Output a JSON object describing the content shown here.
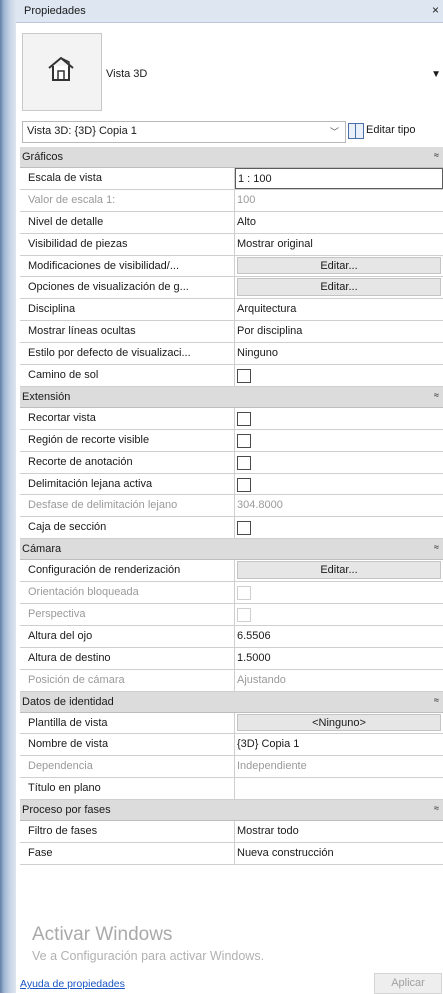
{
  "window": {
    "title": "Propiedades",
    "close": "×"
  },
  "type_selector": {
    "name": "Vista 3D",
    "icon": "house-3d-icon"
  },
  "instance": {
    "selected": "Vista 3D: {3D} Copia 1",
    "edit_type_label": "Editar tipo"
  },
  "sections": [
    {
      "title": "Gráficos",
      "rows": [
        {
          "name": "Escala de vista",
          "kind": "input",
          "value": "1 : 100"
        },
        {
          "name": "Valor de escala    1:",
          "kind": "text",
          "value": "100",
          "disabled": true
        },
        {
          "name": "Nivel de detalle",
          "kind": "text",
          "value": "Alto"
        },
        {
          "name": "Visibilidad de piezas",
          "kind": "text",
          "value": "Mostrar original"
        },
        {
          "name": "Modificaciones de visibilidad/...",
          "kind": "button",
          "value": "Editar..."
        },
        {
          "name": "Opciones de visualización de g...",
          "kind": "button",
          "value": "Editar..."
        },
        {
          "name": "Disciplina",
          "kind": "text",
          "value": "Arquitectura"
        },
        {
          "name": "Mostrar líneas ocultas",
          "kind": "text",
          "value": "Por disciplina"
        },
        {
          "name": "Estilo por defecto de visualizaci...",
          "kind": "text",
          "value": "Ninguno"
        },
        {
          "name": "Camino de sol",
          "kind": "check",
          "checked": false
        }
      ]
    },
    {
      "title": "Extensión",
      "rows": [
        {
          "name": "Recortar vista",
          "kind": "check",
          "checked": false
        },
        {
          "name": "Región de recorte visible",
          "kind": "check",
          "checked": false
        },
        {
          "name": "Recorte de anotación",
          "kind": "check",
          "checked": false
        },
        {
          "name": "Delimitación lejana activa",
          "kind": "check",
          "checked": false
        },
        {
          "name": "Desfase de delimitación lejano",
          "kind": "text",
          "value": "304.8000",
          "disabled": true
        },
        {
          "name": "Caja de sección",
          "kind": "check",
          "checked": false
        }
      ]
    },
    {
      "title": "Cámara",
      "rows": [
        {
          "name": "Configuración de renderización",
          "kind": "button",
          "value": "Editar..."
        },
        {
          "name": "Orientación bloqueada",
          "kind": "check",
          "checked": false,
          "disabled": true
        },
        {
          "name": "Perspectiva",
          "kind": "check",
          "checked": false,
          "disabled": true
        },
        {
          "name": "Altura del ojo",
          "kind": "text",
          "value": "6.5506"
        },
        {
          "name": "Altura de destino",
          "kind": "text",
          "value": "1.5000"
        },
        {
          "name": "Posición de cámara",
          "kind": "text",
          "value": "Ajustando",
          "disabled": true
        }
      ]
    },
    {
      "title": "Datos de identidad",
      "rows": [
        {
          "name": "Plantilla de vista",
          "kind": "button",
          "value": "<Ninguno>"
        },
        {
          "name": "Nombre de vista",
          "kind": "text",
          "value": "{3D} Copia 1"
        },
        {
          "name": "Dependencia",
          "kind": "text",
          "value": "Independiente",
          "disabled": true
        },
        {
          "name": "Título en plano",
          "kind": "text",
          "value": ""
        }
      ]
    },
    {
      "title": "Proceso por fases",
      "rows": [
        {
          "name": "Filtro de fases",
          "kind": "text",
          "value": "Mostrar todo"
        },
        {
          "name": "Fase",
          "kind": "text",
          "value": "Nueva construcción"
        }
      ]
    }
  ],
  "collapse_glyph": "≈",
  "watermark": {
    "line1": "Activar Windows",
    "line2": "Ve a Configuración para activar Windows."
  },
  "footer": {
    "help_link": "Ayuda de propiedades",
    "apply_label": "Aplicar"
  }
}
